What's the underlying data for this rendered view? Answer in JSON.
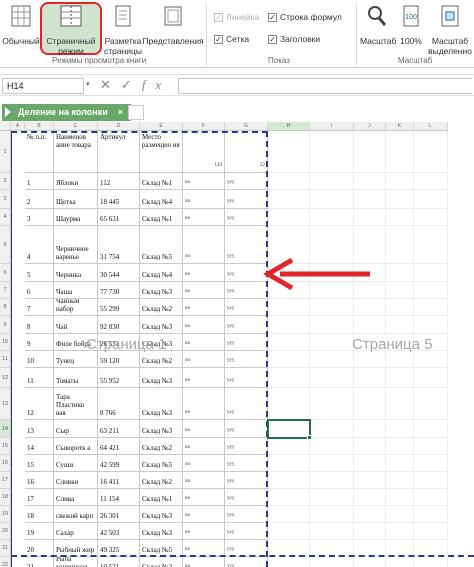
{
  "ribbon": {
    "normal_label": "Обычный",
    "page_mode_label_1": "Страничный",
    "page_mode_label_2": "режим",
    "page_layout_label_1": "Разметка",
    "page_layout_label_2": "страницы",
    "views_label": "Представления",
    "group_views": "Режимы просмотра книги",
    "ruler_label": "Линейка",
    "grid_label": "Сетка",
    "formula_bar_label": "Строка формул",
    "headers_label": "Заголовки",
    "group_show": "Показ",
    "zoom_label": "Масштаб",
    "zoom100_label": "100%",
    "zoomsel_label_1": "Масштаб",
    "zoomsel_label_2": "выделенно",
    "group_zoom": "Масштаб"
  },
  "formula_bar": {
    "name_box": "H14",
    "cancel": "✕",
    "enter": "✓",
    "fx": "fx"
  },
  "sheet_tab": {
    "name": "Деление на колонки",
    "close": "×"
  },
  "columns": [
    "A",
    "B",
    "C",
    "D",
    "E",
    "F",
    "G",
    "H",
    "I",
    "J",
    "K",
    "L"
  ],
  "header_row": {
    "a": "№ п.п.",
    "b": "Наименов ание товара",
    "c": "Артикул",
    "d": "Место размещен ия",
    "e": "123",
    "f": "22"
  },
  "rows": [
    {
      "n": "2",
      "a": "1",
      "b": "Яблоки",
      "c": "112",
      "d": "Склад №1",
      "e": "nn",
      "f": "yyy"
    },
    {
      "n": "3",
      "a": "2",
      "b": "Щетка",
      "c": "18 445",
      "d": "Склад №4",
      "e": "nn",
      "f": "yyy"
    },
    {
      "n": "4",
      "a": "3",
      "b": "Шаурма",
      "c": "65 631",
      "d": "Склад №1",
      "e": "nn",
      "f": "yyy"
    },
    {
      "n": "5",
      "a": "4",
      "b": "Черничное варенье",
      "c": "31 754",
      "d": "Склад №5",
      "e": "nn",
      "f": "yyy"
    },
    {
      "n": "6",
      "a": "5",
      "b": "Черника",
      "c": "30 544",
      "d": "Склад №4",
      "e": "nn",
      "f": "yyy"
    },
    {
      "n": "7",
      "a": "6",
      "b": "Чаша",
      "c": "77 730",
      "d": "Склад №3",
      "e": "nn",
      "f": "yyy"
    },
    {
      "n": "8",
      "a": "7",
      "b": "Чайный набор",
      "c": "55 299",
      "d": "Склад №2",
      "e": "nn",
      "f": "yyy"
    },
    {
      "n": "9",
      "a": "8",
      "b": "Чай",
      "c": "92 830",
      "d": "Склад №3",
      "e": "nn",
      "f": "yyy"
    },
    {
      "n": "10",
      "a": "9",
      "b": "Филе бобра",
      "c": "26 531",
      "d": "Склад №3",
      "e": "nn",
      "f": "yyy"
    },
    {
      "n": "11",
      "a": "10",
      "b": "Тунец",
      "c": "59 120",
      "d": "Склад №2",
      "e": "nn",
      "f": "yyy"
    },
    {
      "n": "12",
      "a": "11",
      "b": "Томаты",
      "c": "55 952",
      "d": "Склад №3",
      "e": "nn",
      "f": "yyy"
    },
    {
      "n": "13",
      "a": "12",
      "b": "Тара Пластико вая",
      "c": "8 766",
      "d": "Склад №3",
      "e": "nn",
      "f": "yyy"
    },
    {
      "n": "14",
      "a": "13",
      "b": "Сыр",
      "c": "63 211",
      "d": "Склад №3",
      "e": "nn",
      "f": "yyy"
    },
    {
      "n": "15",
      "a": "14",
      "b": "Сыворотк а",
      "c": "64 421",
      "d": "Склад №2",
      "e": "nn",
      "f": "yyy"
    },
    {
      "n": "16",
      "a": "15",
      "b": "Суши",
      "c": "42 599",
      "d": "Склад №5",
      "e": "nn",
      "f": "yyy"
    },
    {
      "n": "17",
      "a": "16",
      "b": "Сливки",
      "c": "16 411",
      "d": "Склад №2",
      "e": "nn",
      "f": "yyy"
    },
    {
      "n": "18",
      "a": "17",
      "b": "Слива",
      "c": "11 154",
      "d": "Склад №1",
      "e": "nn",
      "f": "yyy"
    },
    {
      "n": "19",
      "a": "18",
      "b": "свежий карп",
      "c": "26 301",
      "d": "Склад №3",
      "e": "nn",
      "f": "yyy"
    },
    {
      "n": "20",
      "a": "19",
      "b": "Сахар",
      "c": "42 503",
      "d": "Склад №3",
      "e": "nn",
      "f": "yyy"
    },
    {
      "n": "21",
      "a": "20",
      "b": "Рыбный жир",
      "c": "49 325",
      "d": "Склад №5",
      "e": "nn",
      "f": "yyy"
    },
    {
      "n": "22",
      "a": "21",
      "b": "Рыба кончинная",
      "c": "10 521",
      "d": "Склад №2",
      "e": "nn",
      "f": "yyy"
    }
  ],
  "watermark_left": "Страница 1",
  "watermark_right": "Страница 5",
  "colors": {
    "accent": "#217346",
    "highlight_border": "#e0262b",
    "arrow": "#e0262b",
    "page_break": "#2a3a8c"
  }
}
